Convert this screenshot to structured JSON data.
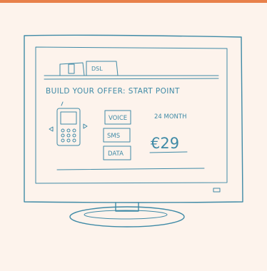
{
  "accent_color": "#e8804a",
  "ink_color": "#3f8aa6",
  "tabs": [
    {
      "label": "",
      "icon": "mobile-phone-icon"
    },
    {
      "label": "DSL"
    }
  ],
  "heading": "BUILD YOUR OFFER: START POINT",
  "options": [
    {
      "label": "VOICE"
    },
    {
      "label": "SMS"
    },
    {
      "label": "DATA"
    }
  ],
  "contract": "24 MONTH",
  "price": "€29",
  "carousel": {
    "prev_icon": "arrow-left-icon",
    "next_icon": "arrow-right-icon"
  }
}
